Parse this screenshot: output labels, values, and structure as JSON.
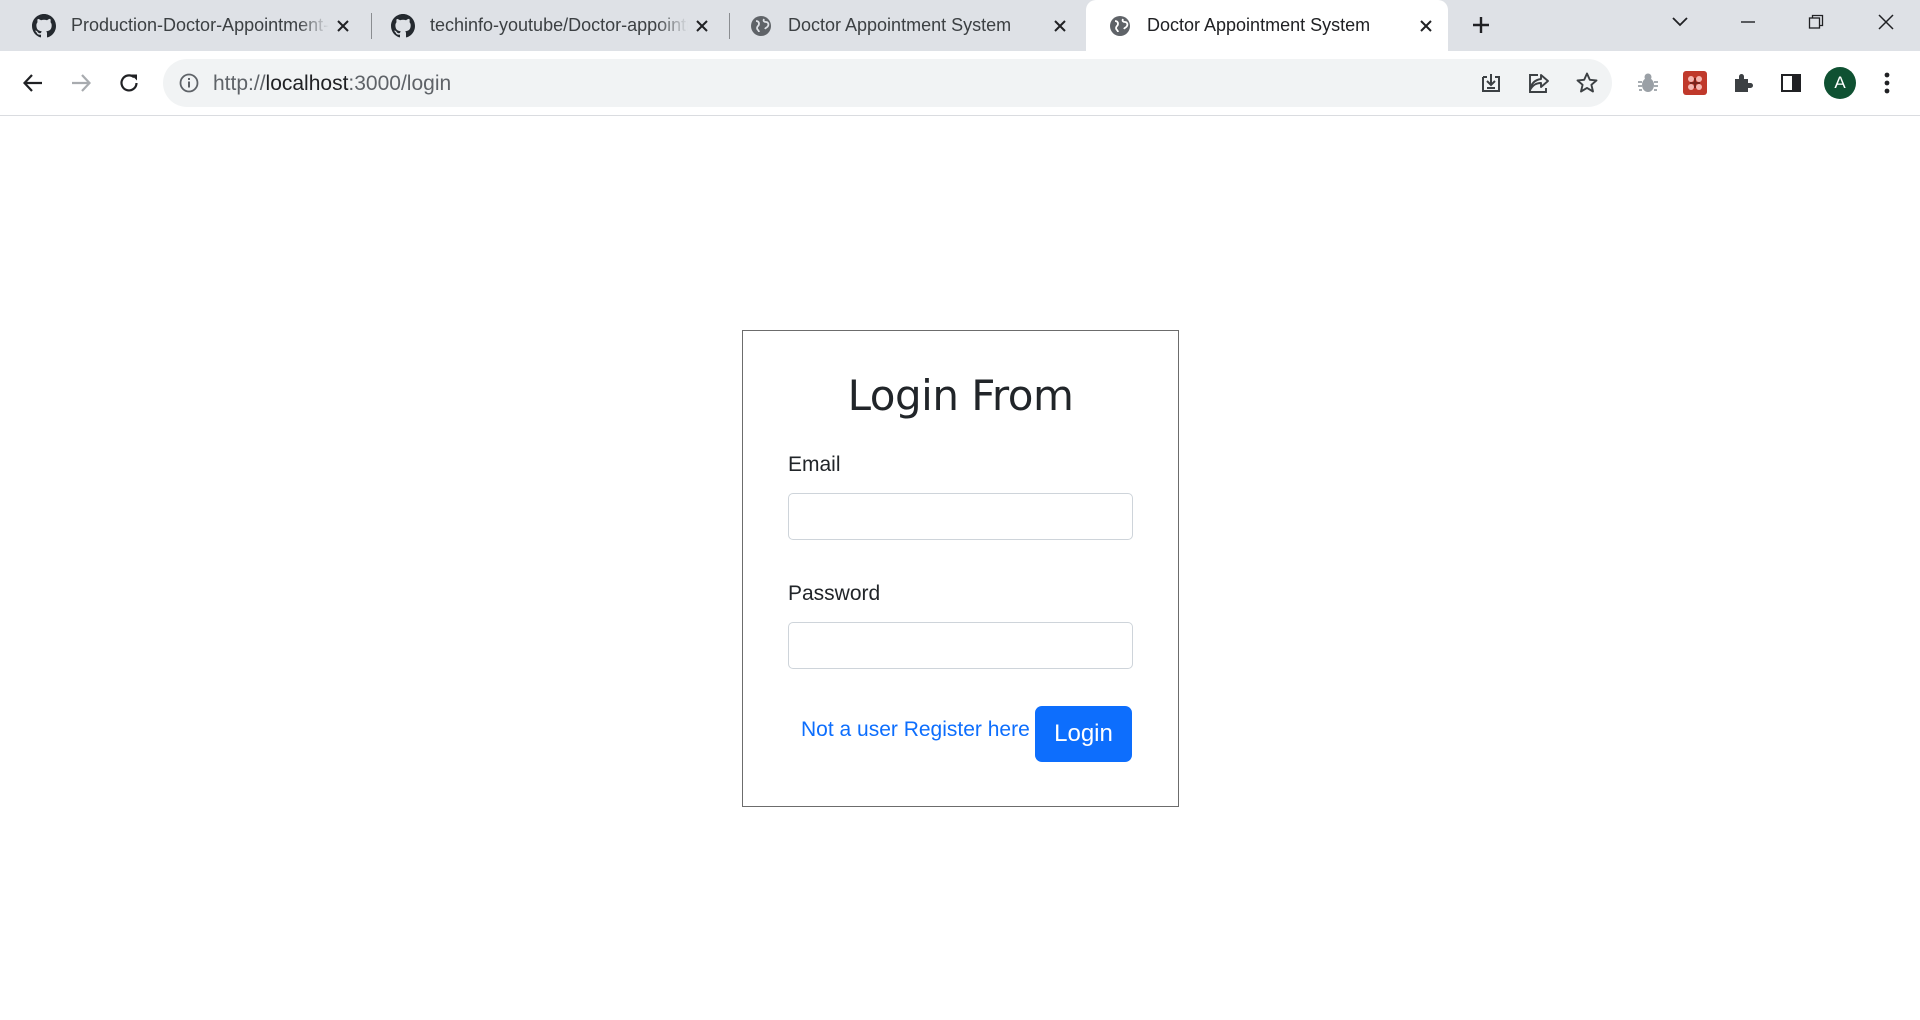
{
  "browser": {
    "tabs": [
      {
        "title": "Production-Doctor-Appointment-System",
        "icon": "github-icon",
        "active": false
      },
      {
        "title": "techinfo-youtube/Doctor-appointment-system",
        "icon": "github-icon",
        "active": false
      },
      {
        "title": "Doctor Appointment System",
        "icon": "globe-icon",
        "active": false
      },
      {
        "title": "Doctor Appointment System",
        "icon": "globe-icon",
        "active": true
      }
    ],
    "url_scheme": "http://",
    "url_host": "localhost",
    "url_path": ":3000/login",
    "profile_initial": "A"
  },
  "login_form": {
    "title": "Login From",
    "email_label": "Email",
    "email_value": "",
    "password_label": "Password",
    "password_value": "",
    "register_link": "Not a user Register here",
    "submit_label": "Login"
  },
  "colors": {
    "primary": "#0d6efd",
    "tab_strip": "#dee1e6",
    "avatar": "#0f5132"
  }
}
